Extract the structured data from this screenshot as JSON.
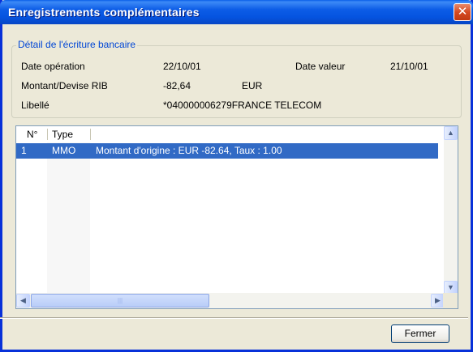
{
  "window": {
    "title": "Enregistrements complémentaires",
    "close_glyph": "✕"
  },
  "details": {
    "legend": "Détail de l'écriture bancaire",
    "date_operation_label": "Date opération",
    "date_operation_value": "22/10/01",
    "date_valeur_label": "Date valeur",
    "date_valeur_value": "21/10/01",
    "montant_label": "Montant/Devise RIB",
    "montant_value": "-82,64",
    "devise_value": "EUR",
    "libelle_label": "Libellé",
    "libelle_value": "*040000006279FRANCE TELECOM"
  },
  "list": {
    "columns": [
      "N°",
      "Type"
    ],
    "rows": [
      {
        "num": "1",
        "type": "MMO",
        "description": "Montant d'origine : EUR -82.64, Taux : 1.00",
        "selected": true
      }
    ]
  },
  "scrollbars": {
    "up_glyph": "▲",
    "down_glyph": "▼",
    "left_glyph": "◀",
    "right_glyph": "▶",
    "thumb_grip": "|||"
  },
  "footer": {
    "close_label": "Fermer"
  },
  "colors": {
    "titlebar": "#0554e0",
    "selection": "#316ac5",
    "legend_text": "#0046d5"
  }
}
